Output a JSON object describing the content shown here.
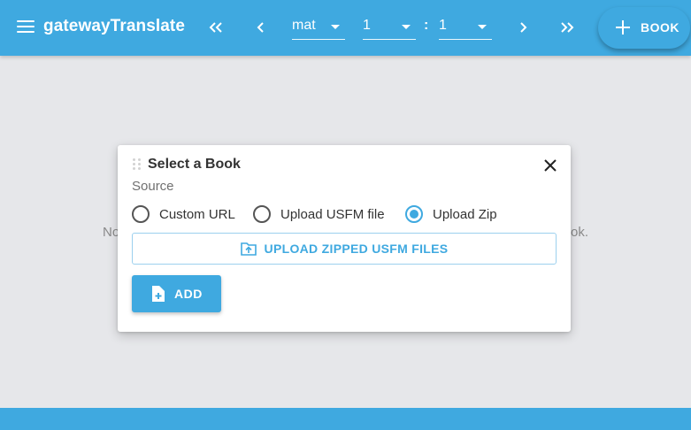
{
  "app": {
    "title": "gatewayTranslate",
    "menu_icon": "menu-icon",
    "brand_color": "#3fa9e0"
  },
  "toolbar": {
    "first_icon": "double-chevron-left-icon",
    "prev_icon": "chevron-left-icon",
    "book_select_value": "mat",
    "chapter_select_value": "1",
    "separator": ":",
    "verse_select_value": "1",
    "next_icon": "chevron-right-icon",
    "last_icon": "double-chevron-right-icon",
    "add_book_label": "BOOK",
    "add_book_icon": "plus-icon"
  },
  "background": {
    "text_left_fragment": "No",
    "text_right_fragment": "ok."
  },
  "dialog": {
    "title": "Select a Book",
    "close_icon": "close-icon",
    "drag_icon": "drag-handle-icon",
    "source_label": "Source",
    "sources": [
      {
        "label": "Custom URL",
        "checked": false
      },
      {
        "label": "Upload USFM file",
        "checked": false
      },
      {
        "label": "Upload Zip",
        "checked": true
      }
    ],
    "upload_label": "UPLOAD ZIPPED USFM FILES",
    "upload_icon": "folder-upload-icon",
    "add_label": "ADD",
    "add_icon": "file-add-icon"
  }
}
